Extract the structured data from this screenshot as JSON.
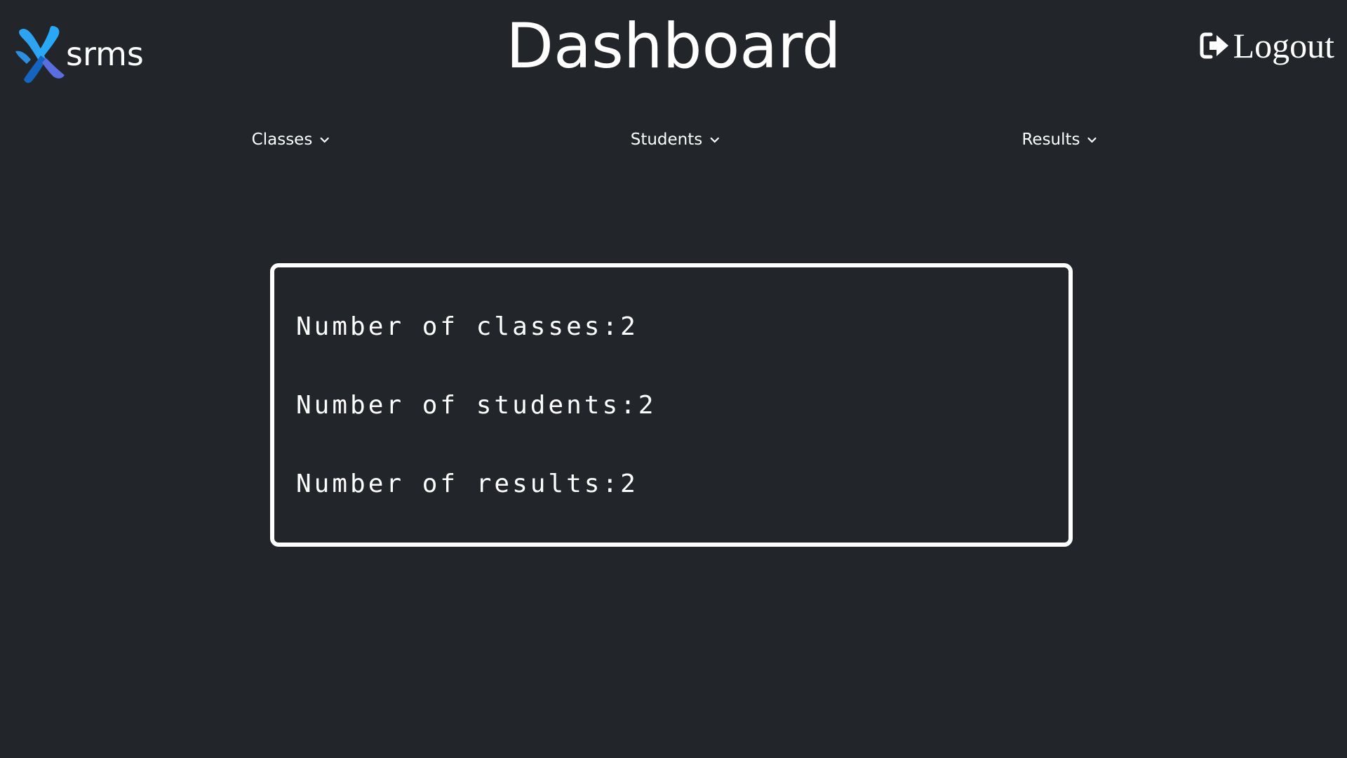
{
  "header": {
    "brand": {
      "name": "srms",
      "logo_icon": "srms-x-logo-icon",
      "colors": [
        "#2ea3f2",
        "#1565c0",
        "#5b6ee1"
      ]
    },
    "title": "Dashboard",
    "logout": {
      "label": "Logout",
      "icon": "sign-out-icon"
    }
  },
  "nav": {
    "items": [
      {
        "label": "Classes",
        "icon": "chevron-down-icon"
      },
      {
        "label": "Students",
        "icon": "chevron-down-icon"
      },
      {
        "label": "Results",
        "icon": "chevron-down-icon"
      }
    ]
  },
  "stats": {
    "lines": [
      {
        "label": "Number of classes:2"
      },
      {
        "label": "Number of students:2"
      },
      {
        "label": "Number of results:2"
      }
    ]
  },
  "theme": {
    "background": "#222529",
    "foreground": "#ffffff"
  }
}
